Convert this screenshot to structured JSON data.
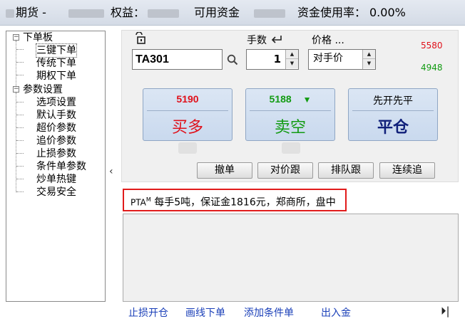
{
  "topbar": {
    "account_suffix": "期货 -",
    "equity_label": "权益：",
    "available_label": "可用资金",
    "usage_label": "资金使用率：",
    "usage_value": "0.00%"
  },
  "tree": {
    "group1": {
      "label": "下单板",
      "children": [
        "三键下单",
        "传统下单",
        "期权下单"
      ]
    },
    "group2": {
      "label": "参数设置",
      "children": [
        "选项设置",
        "默认手数",
        "超价参数",
        "追价参数",
        "止损参数",
        "条件单参数",
        "炒单热键",
        "交易安全"
      ]
    }
  },
  "order": {
    "code_value": "TA301",
    "qty_label": "手数",
    "qty_value": "1",
    "price_label": "价格 ...",
    "price_value": "对手价",
    "ask_price": "5580",
    "bid_price": "4948"
  },
  "buttons": {
    "buy": {
      "price": "5190",
      "action": "买多"
    },
    "sell": {
      "price": "5188",
      "action": "卖空",
      "trend": "▼"
    },
    "close": {
      "price": "先开先平",
      "action": "平仓"
    },
    "cancel": "撤单",
    "match": "对价跟",
    "queue": "排队跟",
    "chase": "连续追"
  },
  "info": {
    "symbol": "PTA",
    "mark": "M",
    "text": " 每手5吨，保证金1816元，郑商所，盘中"
  },
  "bottom": [
    "止损开仓",
    "画线下单",
    "添加条件单",
    "出入金"
  ],
  "colors": {
    "red": "#e0101a",
    "green": "#129b12",
    "navy": "#10207a"
  }
}
